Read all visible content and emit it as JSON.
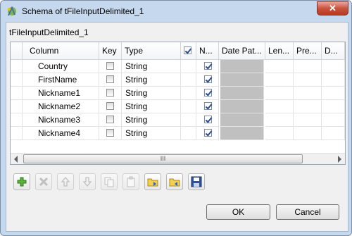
{
  "window": {
    "title": "Schema of tFileInputDelimited_1",
    "close_symbol": "✕"
  },
  "schema_label": "tFileInputDelimited_1",
  "table": {
    "headers": [
      "Column",
      "Key",
      "Type",
      "",
      "N...",
      "Date Pat...",
      "Len...",
      "Pre...",
      "D..."
    ],
    "rows": [
      {
        "column": "Country",
        "key": false,
        "type": "String",
        "nullable": true
      },
      {
        "column": "FirstName",
        "key": false,
        "type": "String",
        "nullable": true
      },
      {
        "column": "Nickname1",
        "key": false,
        "type": "String",
        "nullable": true
      },
      {
        "column": "Nickname2",
        "key": false,
        "type": "String",
        "nullable": true
      },
      {
        "column": "Nickname3",
        "key": false,
        "type": "String",
        "nullable": true
      },
      {
        "column": "Nickname4",
        "key": false,
        "type": "String",
        "nullable": true
      }
    ],
    "scroll_thumb_grip": "III"
  },
  "toolbar": {
    "buttons": [
      {
        "icon": "add-icon",
        "enabled": true
      },
      {
        "icon": "delete-icon",
        "enabled": false
      },
      {
        "icon": "move-up-icon",
        "enabled": false
      },
      {
        "icon": "move-down-icon",
        "enabled": false
      },
      {
        "icon": "copy-icon",
        "enabled": false
      },
      {
        "icon": "paste-icon",
        "enabled": false
      },
      {
        "icon": "import-icon",
        "enabled": true
      },
      {
        "icon": "export-icon",
        "enabled": true
      },
      {
        "icon": "save-icon",
        "enabled": true
      }
    ]
  },
  "buttons": {
    "ok": "OK",
    "cancel": "Cancel"
  },
  "colors": {
    "title_bg": "#c6d8ee",
    "close": "#c9533b",
    "disabled_cell": "#c0c0c0"
  }
}
